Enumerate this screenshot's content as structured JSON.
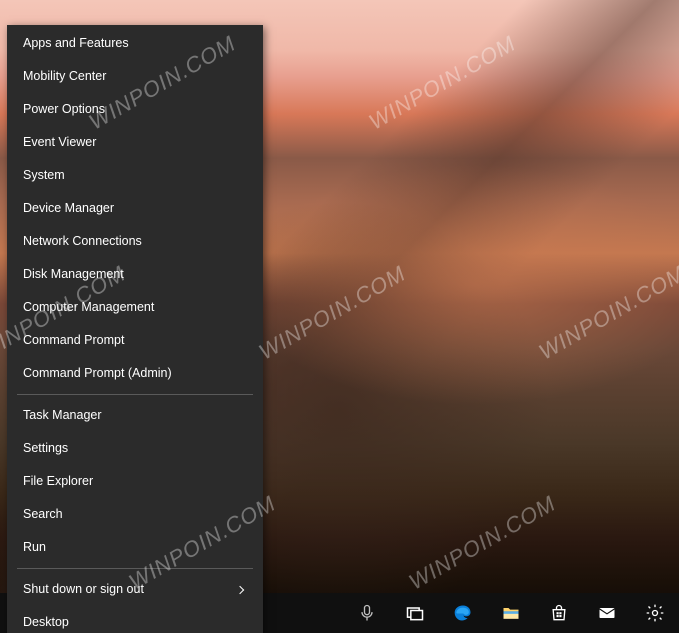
{
  "menu": {
    "groups": [
      [
        {
          "label": "Apps and Features",
          "name": "menu-apps-features"
        },
        {
          "label": "Mobility Center",
          "name": "menu-mobility-center"
        },
        {
          "label": "Power Options",
          "name": "menu-power-options"
        },
        {
          "label": "Event Viewer",
          "name": "menu-event-viewer"
        },
        {
          "label": "System",
          "name": "menu-system"
        },
        {
          "label": "Device Manager",
          "name": "menu-device-manager"
        },
        {
          "label": "Network Connections",
          "name": "menu-network-connections"
        },
        {
          "label": "Disk Management",
          "name": "menu-disk-management"
        },
        {
          "label": "Computer Management",
          "name": "menu-computer-management"
        },
        {
          "label": "Command Prompt",
          "name": "menu-command-prompt"
        },
        {
          "label": "Command Prompt (Admin)",
          "name": "menu-command-prompt-admin"
        }
      ],
      [
        {
          "label": "Task Manager",
          "name": "menu-task-manager"
        },
        {
          "label": "Settings",
          "name": "menu-settings"
        },
        {
          "label": "File Explorer",
          "name": "menu-file-explorer"
        },
        {
          "label": "Search",
          "name": "menu-search"
        },
        {
          "label": "Run",
          "name": "menu-run"
        }
      ],
      [
        {
          "label": "Shut down or sign out",
          "name": "menu-shutdown-signout",
          "submenu": true
        },
        {
          "label": "Desktop",
          "name": "menu-desktop"
        }
      ]
    ]
  },
  "taskbar": {
    "icons": [
      {
        "name": "cortana-mic-icon"
      },
      {
        "name": "task-view-icon"
      },
      {
        "name": "edge-icon"
      },
      {
        "name": "file-explorer-icon"
      },
      {
        "name": "store-icon"
      },
      {
        "name": "mail-icon"
      },
      {
        "name": "settings-gear-icon"
      }
    ]
  },
  "watermark": {
    "text": "WINPOIN.COM"
  }
}
